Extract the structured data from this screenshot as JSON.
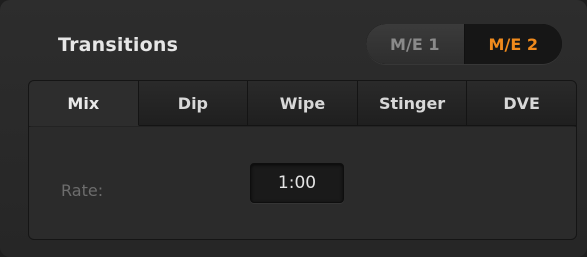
{
  "panel": {
    "title": "Transitions"
  },
  "me_switch": {
    "options": [
      {
        "label": "M/E 1",
        "selected": false
      },
      {
        "label": "M/E 2",
        "selected": true
      }
    ],
    "accent_color": "#f08a1c"
  },
  "tabs": [
    {
      "label": "Mix",
      "active": true
    },
    {
      "label": "Dip",
      "active": false
    },
    {
      "label": "Wipe",
      "active": false
    },
    {
      "label": "Stinger",
      "active": false
    },
    {
      "label": "DVE",
      "active": false
    }
  ],
  "mix": {
    "rate_label": "Rate:",
    "rate_value": "1:00"
  }
}
